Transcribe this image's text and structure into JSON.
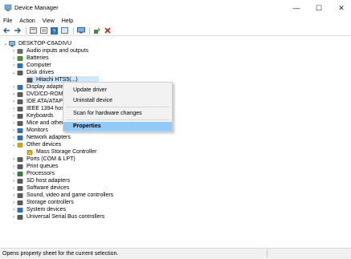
{
  "window": {
    "title": "Device Manager",
    "minimize": "—",
    "maximize": "☐",
    "close": "✕"
  },
  "menu": [
    "File",
    "Action",
    "View",
    "Help"
  ],
  "toolbar": {
    "icons": [
      "back-icon",
      "forward-icon",
      "show-hidden-icon",
      "properties-icon",
      "help-icon",
      "view-icon",
      "monitor-icon",
      "update-driver-icon",
      "uninstall-icon"
    ]
  },
  "tree": {
    "root": "DESKTOP-C6ADIVU",
    "items": [
      {
        "label": "Audio inputs and outputs",
        "icon": "speaker-icon",
        "color": "#6a6a6a"
      },
      {
        "label": "Batteries",
        "icon": "battery-icon",
        "color": "#4a8c3a"
      },
      {
        "label": "Computer",
        "icon": "computer-icon",
        "color": "#2c6fb7"
      },
      {
        "label": "Disk drives",
        "icon": "disk-icon",
        "color": "#5a5a5a"
      },
      {
        "label": "Hitachi HTS5(...)",
        "icon": "disk-icon",
        "color": "#5a5a5a"
      },
      {
        "label": "Display adapters",
        "icon": "display-icon",
        "color": "#2c6fb7"
      },
      {
        "label": "DVD/CD-ROM dr",
        "icon": "dvd-icon",
        "color": "#5a5a5a"
      },
      {
        "label": "IDE ATA/ATAPI co",
        "icon": "ide-icon",
        "color": "#5a5a5a"
      },
      {
        "label": "IEEE 1394 host co",
        "icon": "ieee-icon",
        "color": "#5a5a5a"
      },
      {
        "label": "Keyboards",
        "icon": "keyboard-icon",
        "color": "#5a5a5a"
      },
      {
        "label": "Mice and other pointing devices",
        "icon": "mouse-icon",
        "color": "#5a5a5a"
      },
      {
        "label": "Monitors",
        "icon": "monitor-icon",
        "color": "#2c6fb7"
      },
      {
        "label": "Network adapters",
        "icon": "network-icon",
        "color": "#2c6fb7"
      },
      {
        "label": "Other devices",
        "icon": "other-devices-icon",
        "color": "#c9a227"
      },
      {
        "label": "Mass Storage Controller",
        "icon": "warning-device-icon",
        "color": "#c9a227"
      },
      {
        "label": "Ports (COM & LPT)",
        "icon": "port-icon",
        "color": "#5a5a5a"
      },
      {
        "label": "Print queues",
        "icon": "printer-icon",
        "color": "#5a5a5a"
      },
      {
        "label": "Processors",
        "icon": "processor-icon",
        "color": "#3a7a3a"
      },
      {
        "label": "SD host adapters",
        "icon": "sd-icon",
        "color": "#5a5a5a"
      },
      {
        "label": "Software devices",
        "icon": "software-icon",
        "color": "#5a5a5a"
      },
      {
        "label": "Sound, video and game controllers",
        "icon": "sound-icon",
        "color": "#5a5a5a"
      },
      {
        "label": "Storage controllers",
        "icon": "storage-icon",
        "color": "#5a5a5a"
      },
      {
        "label": "System devices",
        "icon": "system-icon",
        "color": "#2c6fb7"
      },
      {
        "label": "Universal Serial Bus controllers",
        "icon": "usb-icon",
        "color": "#5a5a5a"
      }
    ]
  },
  "context_menu": {
    "items": [
      "Update driver",
      "Uninstall device",
      "Scan for hardware changes",
      "Properties"
    ]
  },
  "status": {
    "text": "Opens property sheet for the current selection."
  }
}
